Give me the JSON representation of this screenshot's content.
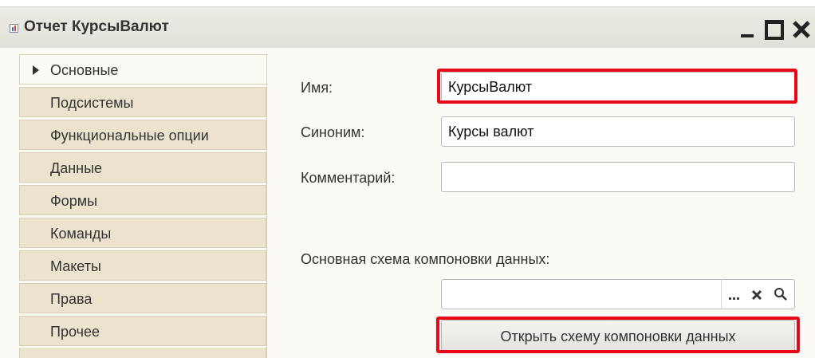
{
  "window": {
    "title": "Отчет КурсыВалют",
    "controls": {
      "minimize": "minimize",
      "maximize": "maximize",
      "close": "close"
    }
  },
  "tabs": [
    {
      "label": "Основные",
      "active": true
    },
    {
      "label": "Подсистемы",
      "active": false
    },
    {
      "label": "Функциональные опции",
      "active": false
    },
    {
      "label": "Данные",
      "active": false
    },
    {
      "label": "Формы",
      "active": false
    },
    {
      "label": "Команды",
      "active": false
    },
    {
      "label": "Макеты",
      "active": false
    },
    {
      "label": "Права",
      "active": false
    },
    {
      "label": "Прочее",
      "active": false
    }
  ],
  "form": {
    "name": {
      "label": "Имя:",
      "value": "КурсыВалют"
    },
    "synonym": {
      "label": "Синоним:",
      "value": "Курсы валют"
    },
    "comment": {
      "label": "Комментарий:",
      "value": ""
    },
    "dcs": {
      "label": "Основная схема компоновки данных:",
      "value": ""
    },
    "open_button_label": "Открыть схему компоновки данных"
  },
  "icons": {
    "title": "report-icon",
    "active_tab": "triangle-right-icon",
    "select": "ellipsis-icon",
    "clear": "clear-x-icon",
    "search": "search-icon"
  },
  "colors": {
    "highlight": "#e8081a",
    "tab_background": "#ebe3cd",
    "panel_background": "#fbfaf5"
  }
}
